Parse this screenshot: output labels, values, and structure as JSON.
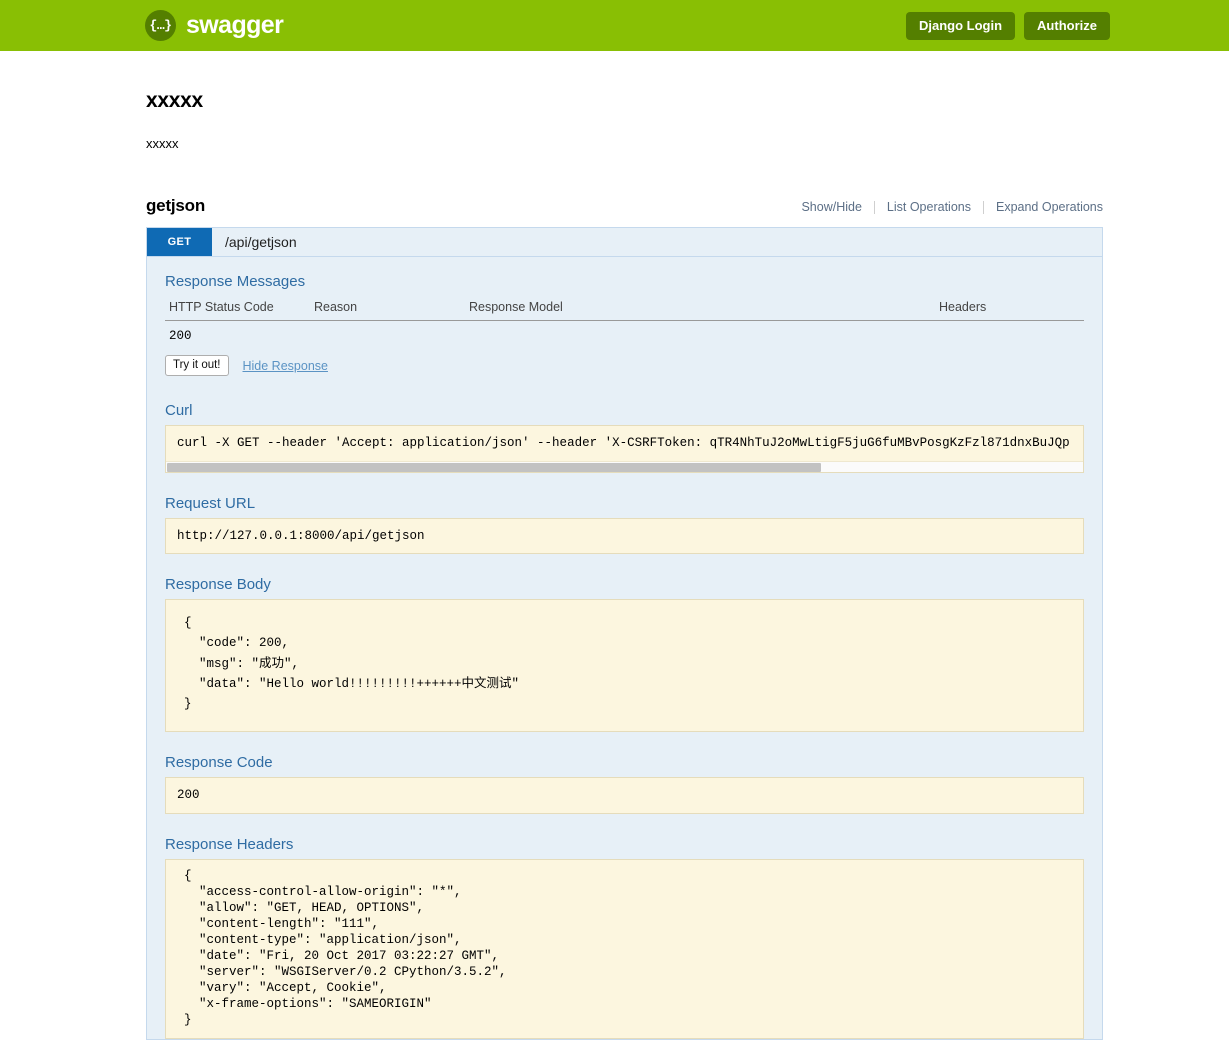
{
  "header": {
    "logo_glyph": "{…}",
    "brand": "swagger",
    "django_login_label": "Django Login",
    "authorize_label": "Authorize"
  },
  "info": {
    "title": "xxxxx",
    "description": "xxxxx"
  },
  "resource": {
    "name": "getjson",
    "links": {
      "show_hide": "Show/Hide",
      "list_operations": "List Operations",
      "expand_operations": "Expand Operations"
    }
  },
  "operation": {
    "method": "GET",
    "path": "/api/getjson",
    "response_messages_title": "Response Messages",
    "table": {
      "headers": [
        "HTTP Status Code",
        "Reason",
        "Response Model",
        "Headers"
      ],
      "rows": [
        {
          "status": "200",
          "reason": "",
          "model": "",
          "headers": ""
        }
      ]
    },
    "try_button": "Try it out!",
    "hide_response": "Hide Response",
    "curl_title": "Curl",
    "curl_command": "curl -X GET --header 'Accept: application/json' --header 'X-CSRFToken: qTR4NhTuJ2oMwLtigF5juG6fuMBvPosgKzFzl871dnxBuJQp",
    "request_url_title": "Request URL",
    "request_url": "http://127.0.0.1:8000/api/getjson",
    "response_body_title": "Response Body",
    "response_body": "{\n  \"code\": 200,\n  \"msg\": \"成功\",\n  \"data\": \"Hello world!!!!!!!!!++++++中文测试\"\n}",
    "response_code_title": "Response Code",
    "response_code": "200",
    "response_headers_title": "Response Headers",
    "response_headers": "{\n  \"access-control-allow-origin\": \"*\",\n  \"allow\": \"GET, HEAD, OPTIONS\",\n  \"content-length\": \"111\",\n  \"content-type\": \"application/json\",\n  \"date\": \"Fri, 20 Oct 2017 03:22:27 GMT\",\n  \"server\": \"WSGIServer/0.2 CPython/3.5.2\",\n  \"vary\": \"Accept, Cookie\",\n  \"x-frame-options\": \"SAMEORIGIN\"\n}"
  },
  "colors": {
    "brand_green": "#89bf04",
    "button_green": "#547f00",
    "method_blue": "#0f6ab4",
    "panel_blue": "#e7f0f7",
    "code_cream": "#fcf6df",
    "section_heading": "#2f6ca3"
  }
}
